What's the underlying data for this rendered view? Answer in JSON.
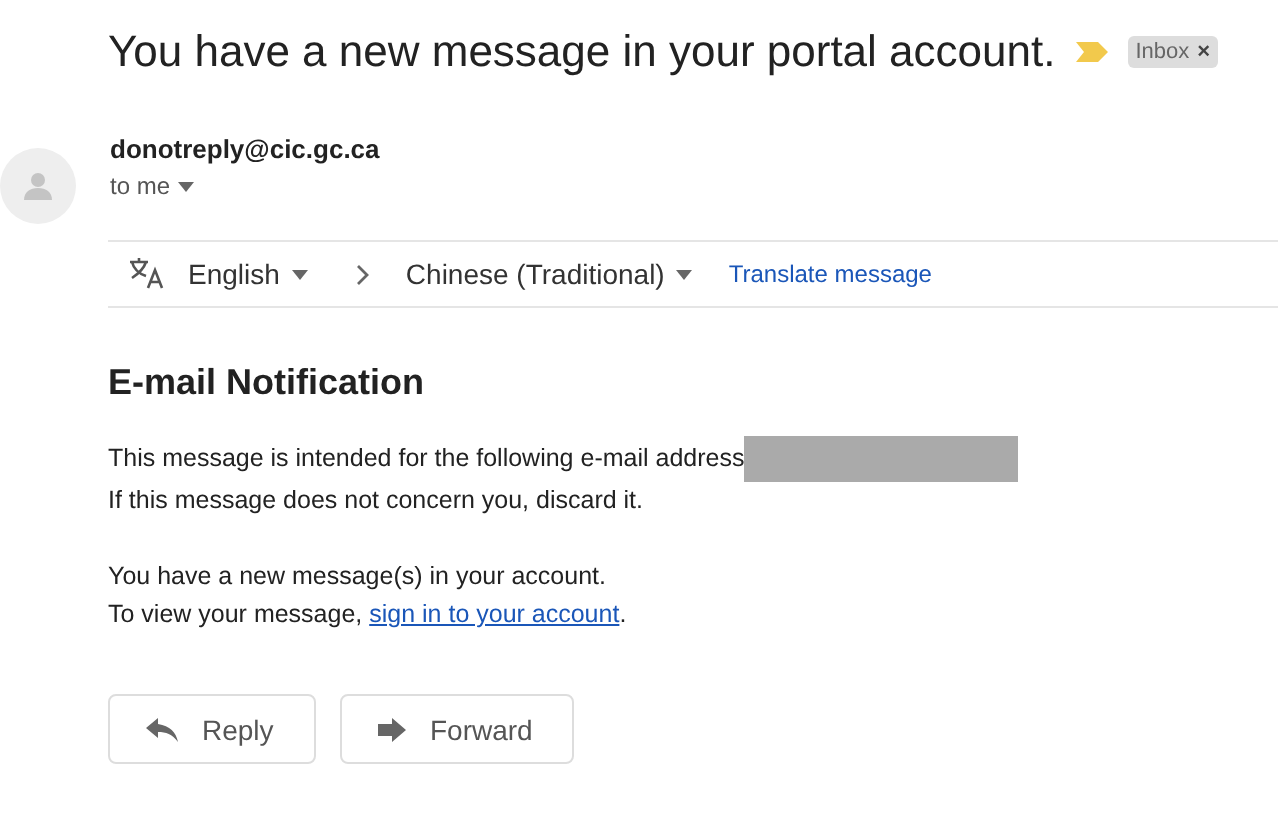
{
  "subject": "You have a new message in your portal account.",
  "important": true,
  "labels": [
    {
      "text": "Inbox",
      "close": "×"
    }
  ],
  "sender": {
    "email": "donotreply@cic.gc.ca",
    "to": "to me"
  },
  "translate": {
    "from": "English",
    "to": "Chinese (Traditional)",
    "action": "Translate message"
  },
  "heading": "E-mail Notification",
  "lines": [
    {
      "text": "This message is intended for the following e-mail address",
      "redacted": true
    },
    {
      "text": "If this message does not concern you, discard it.",
      "redacted": false
    }
  ],
  "lines2": [
    {
      "text": "You have a new message(s) in your account."
    }
  ],
  "link_line": {
    "before": "To view your message, ",
    "link": "sign in to your account",
    "after": "."
  },
  "buttons": [
    {
      "label": "Reply",
      "kind": "reply"
    },
    {
      "label": "Forward",
      "kind": "forward"
    }
  ]
}
